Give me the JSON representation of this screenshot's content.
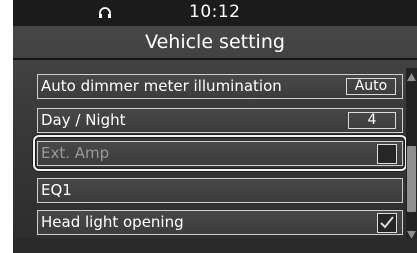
{
  "status_bar": {
    "time": "10:12",
    "icon": "headset-icon"
  },
  "header": {
    "title": "Vehicle setting"
  },
  "settings": [
    {
      "label": "Auto dimmer meter illumination",
      "value": "Auto",
      "control": "value-box",
      "enabled": true
    },
    {
      "label": "Day / Night",
      "value": "4",
      "control": "value-box",
      "enabled": true
    },
    {
      "label": "Ext. Amp",
      "checked": false,
      "control": "checkbox",
      "enabled": false,
      "focused": true
    },
    {
      "label": "EQ1",
      "control": "none",
      "enabled": true
    },
    {
      "label": "Head light opening",
      "checked": true,
      "control": "checkbox",
      "enabled": true
    }
  ],
  "scrollbar": {
    "up_icon": "scroll-up-arrow-icon",
    "down_icon": "scroll-down-arrow-icon",
    "position": 0.45
  },
  "colors": {
    "screen_bg": "#3a3a3a",
    "text": "#ffffff",
    "disabled_text": "#9a9a9a",
    "row_border": "#cfcfcf"
  }
}
